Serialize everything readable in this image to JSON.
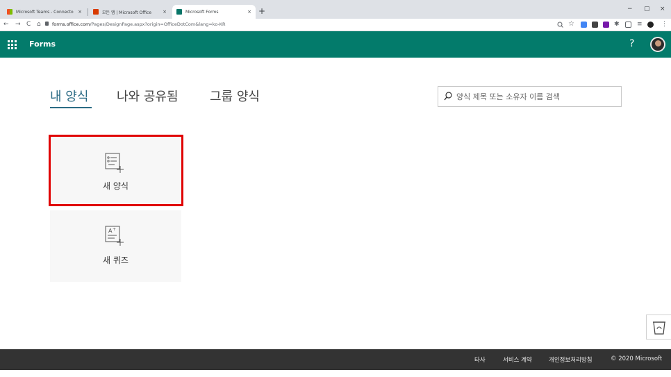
{
  "browser": {
    "tabs": [
      {
        "title": "Microsoft Teams - Connectors |",
        "close": "×",
        "favicon_color": "#f25022"
      },
      {
        "title": "모든 앱 | Microsoft Office",
        "close": "×",
        "favicon_color": "#d83b01"
      },
      {
        "title": "Microsoft Forms",
        "close": "×",
        "favicon_color": "#077568"
      }
    ],
    "new_tab": "+",
    "window_controls": [
      "−",
      "▢",
      "×"
    ],
    "nav": {
      "back": "←",
      "forward": "→",
      "reload": "C",
      "home": "⌂"
    },
    "url_domain": "forms.office.com",
    "url_path": "/Pages/DesignPage.aspx?origin=OfficeDotCom&lang=ko-KR",
    "toolbar_icons": [
      "zoom-icon",
      "star-icon",
      "extension-icon",
      "qr-icon",
      "onenote-icon",
      "puzzle-icon",
      "cast-icon",
      "reading-list-icon",
      "profile-icon",
      "menu-icon"
    ]
  },
  "header": {
    "app_name": "Forms",
    "help": "?"
  },
  "tabs": {
    "my_forms": "내 양식",
    "shared": "나와 공유됨",
    "group": "그룹 양식"
  },
  "search": {
    "placeholder": "양식 제목 또는 소유자 이름 검색"
  },
  "cards": {
    "new_form": "새 양식",
    "new_quiz": "새 퀴즈"
  },
  "footer": {
    "third_party": "타사",
    "terms": "서비스 계약",
    "privacy": "개인정보처리방침",
    "copyright": "© 2020 Microsoft"
  },
  "colors": {
    "brand": "#037b6b",
    "highlight": "#e00000",
    "footer": "#333333"
  }
}
